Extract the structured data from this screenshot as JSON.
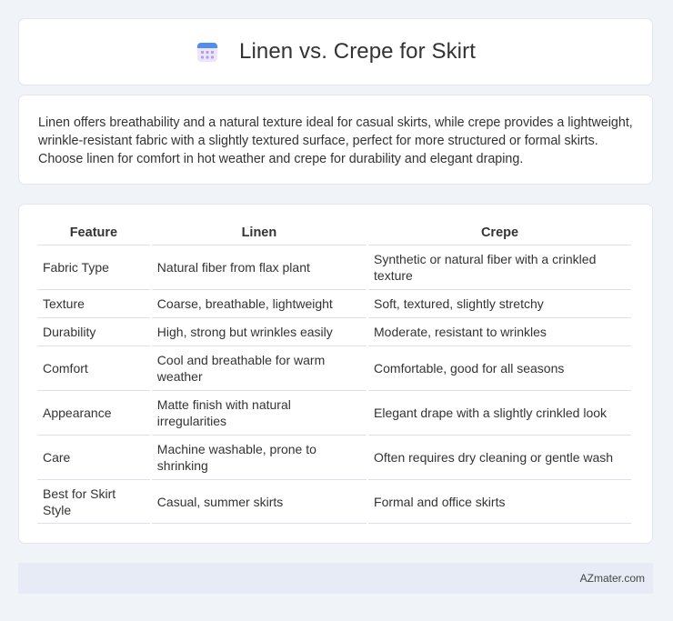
{
  "header": {
    "icon": "calendar-icon",
    "title": "Linen vs. Crepe for Skirt"
  },
  "summary": {
    "text": "Linen offers breathability and a natural texture ideal for casual skirts, while crepe provides a lightweight, wrinkle-resistant fabric with a slightly textured surface, perfect for more structured or formal skirts. Choose linen for comfort in hot weather and crepe for durability and elegant draping."
  },
  "table": {
    "headers": [
      "Feature",
      "Linen",
      "Crepe"
    ],
    "rows": [
      [
        "Fabric Type",
        "Natural fiber from flax plant",
        "Synthetic or natural fiber with a crinkled texture"
      ],
      [
        "Texture",
        "Coarse, breathable, lightweight",
        "Soft, textured, slightly stretchy"
      ],
      [
        "Durability",
        "High, strong but wrinkles easily",
        "Moderate, resistant to wrinkles"
      ],
      [
        "Comfort",
        "Cool and breathable for warm weather",
        "Comfortable, good for all seasons"
      ],
      [
        "Appearance",
        "Matte finish with natural irregularities",
        "Elegant drape with a slightly crinkled look"
      ],
      [
        "Care",
        "Machine washable, prone to shrinking",
        "Often requires dry cleaning or gentle wash"
      ],
      [
        "Best for Skirt Style",
        "Casual, summer skirts",
        "Formal and office skirts"
      ]
    ]
  },
  "footer": {
    "text": "AZmater.com"
  }
}
